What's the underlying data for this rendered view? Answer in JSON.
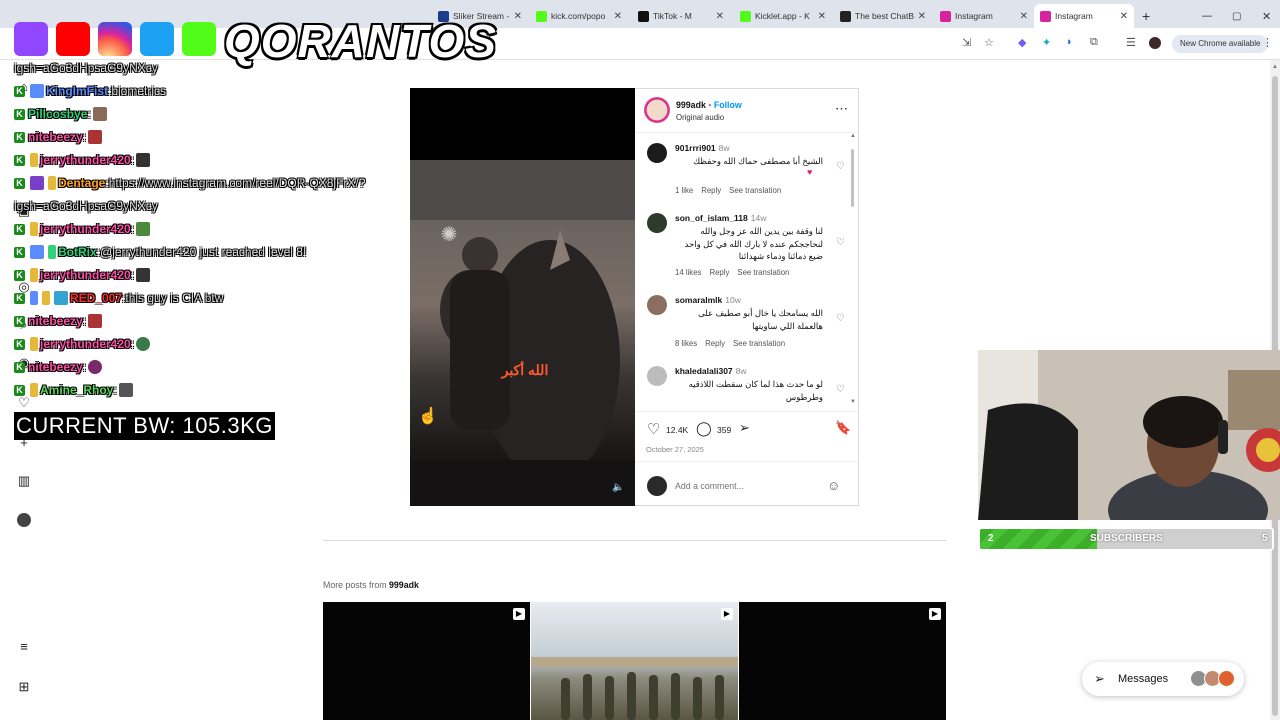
{
  "browser": {
    "tabs": [
      {
        "label": "Sliker Stream -",
        "color": "#1c3c8c"
      },
      {
        "label": "kick.com/popo",
        "color": "#53fc18"
      },
      {
        "label": "TikTok - M",
        "color": "#111111"
      },
      {
        "label": "Kicklet.app - K",
        "color": "#53fc18"
      },
      {
        "label": "The best ChatB",
        "color": "#222222"
      },
      {
        "label": "Instagram",
        "color": "#d6249f"
      },
      {
        "label": "Instagram",
        "color": "#d6249f"
      }
    ],
    "new_chrome_label": "New Chrome available"
  },
  "stream": {
    "logo_text": "QORANTOS",
    "current_bw": "CURRENT BW: 105.3KG",
    "chat": [
      {
        "user": "",
        "text": "igsh=aGo3dHpsaG9yNXcy",
        "color": "#cccccc"
      },
      {
        "user": "KingImFist",
        "sep": " : ",
        "text": "biometrics",
        "color": "#5b8cff"
      },
      {
        "user": "Pillcosbye",
        "sep": " : ",
        "text": "",
        "color": "#33d17a"
      },
      {
        "user": "nitebeezy",
        "sep": " : ",
        "text": "",
        "color": "#ff4da6"
      },
      {
        "user": "jerrythunder420",
        "sep": " : ",
        "text": "",
        "color": "#ff4da6"
      },
      {
        "user": "Dentage",
        "sep": " : ",
        "text": "https://www.instagram.com/reel/DQR-QX8jFrX/?",
        "color": "#ffa31a"
      },
      {
        "user": "",
        "text": "igsh=aGo3dHpsaG9yNXcy",
        "color": "#cccccc"
      },
      {
        "user": "jerrythunder420",
        "sep": " : ",
        "text": "",
        "color": "#ff4da6"
      },
      {
        "user": "BotRix",
        "sep": " : ",
        "text": "@jerrythunder420 just reached level 8!",
        "color": "#33d17a"
      },
      {
        "user": "jerrythunder420",
        "sep": " : ",
        "text": "",
        "color": "#ff4da6"
      },
      {
        "user": "RED_007",
        "sep": " : ",
        "text": "this guy is CIA btw",
        "color": "#ff2a2a"
      },
      {
        "user": "nitebeezy",
        "sep": " : ",
        "text": "",
        "color": "#ff4da6"
      },
      {
        "user": "jerrythunder420",
        "sep": " : ",
        "text": "",
        "color": "#ff4da6"
      },
      {
        "user": "nitebeezy",
        "sep": " : ",
        "text": "",
        "color": "#ff4da6"
      },
      {
        "user": "Amine_Rhoy",
        "sep": " : ",
        "text": "",
        "color": "#5cd65c"
      }
    ],
    "subscribers": {
      "current": "2",
      "label": "SUBSCRIBERS",
      "goal": "5",
      "progress": 0.4
    }
  },
  "post": {
    "username": "999adk",
    "follow_label": "Follow",
    "audio": "Original audio",
    "video_caption": "الله أكبر",
    "comments": [
      {
        "user": "901rrri901",
        "time": "8w",
        "text": "الشيخ أبا مصطفى حماك الله وحفظك",
        "likes": "1 like",
        "reply": "Reply",
        "translate": "See translation"
      },
      {
        "user": "son_of_islam_118",
        "time": "14w",
        "text": "لنا وقفة بين يدين الله عز وجل والله لنحاججكم عنده لا بارك الله في كل واحد ضيع دمائنا ودماء شهدائنا",
        "likes": "14 likes",
        "reply": "Reply",
        "translate": "See translation"
      },
      {
        "user": "somaralmlk",
        "time": "10w",
        "text": "الله يسامحك يا خال أبو صطيف على هالعملة اللي ساويتها",
        "likes": "8 likes",
        "reply": "Reply",
        "translate": "See translation"
      },
      {
        "user": "khaledalali307",
        "time": "8w",
        "text": "لو ما حدث هذا لما كان سقطت اللاذقيه وطرطوس",
        "likes": "",
        "reply": "",
        "translate": ""
      }
    ],
    "like_count": "12.4K",
    "comment_count": "359",
    "date": "October 27, 2025",
    "add_comment_placeholder": "Add a comment...",
    "more_posts_prefix": "More posts from",
    "more_posts_user": "999adk"
  },
  "messages_label": "Messages"
}
